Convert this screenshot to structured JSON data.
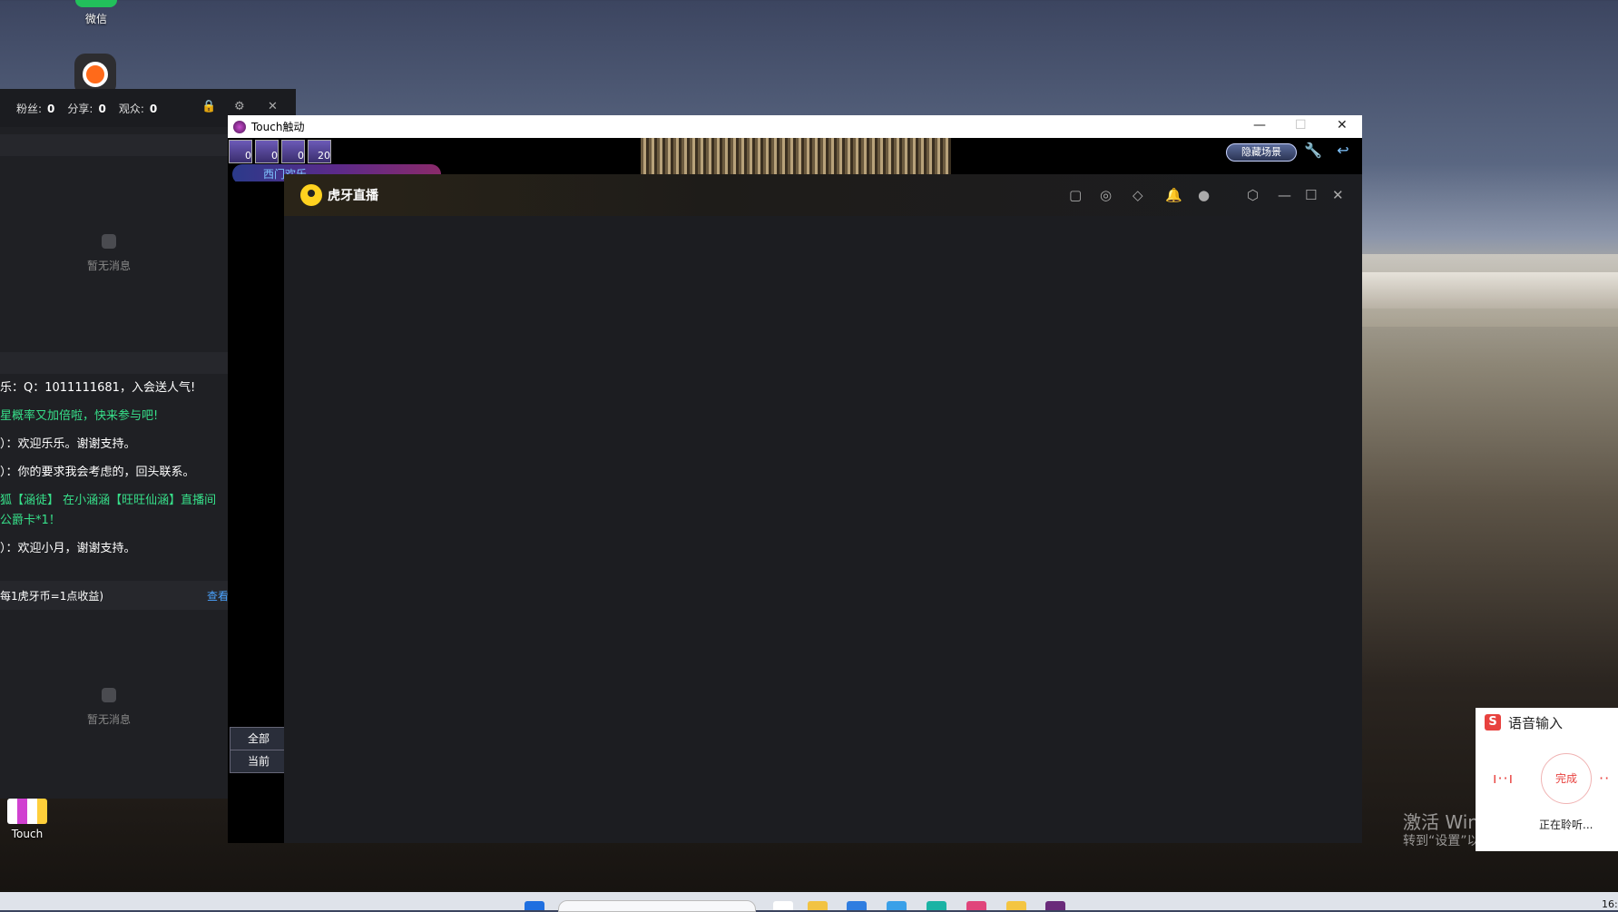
{
  "desktop": {
    "wechat_label": "微信",
    "touch_label": "Touch",
    "activate_line1": "激活 Windows",
    "activate_line2": "转到“设置”以激活 Windows。",
    "clock": "16:"
  },
  "left_panel": {
    "fans_label": "粉丝:",
    "fans_value": "0",
    "share_label": "分享:",
    "share_value": "0",
    "viewers_label": "观众:",
    "viewers_value": "0",
    "empty_top": "暂无消息",
    "empty_bottom": "暂无消息",
    "chat": [
      "乐：Q：1011111681，入会送人气!",
      "星概率又加倍啦，快来参与吧!",
      "）：欢迎乐乐。谢谢支持。",
      "）：你的要求我会考虑的，回头联系。",
      "狐【涵徒】 在小涵涵【旺旺仙涵】直播间",
      "公爵卡*1！",
      "）：欢迎小月，谢谢支持。"
    ],
    "coin_note": "每1虎牙币=1点收益)",
    "coin_link": "查看"
  },
  "game_window": {
    "title": "Touch触动",
    "badges": [
      "0",
      "0",
      "0",
      "20"
    ],
    "hide_scene": "隐藏场景",
    "player_name": "西门欢乐",
    "tab_all": "全部",
    "tab_current": "当前"
  },
  "huya_window": {
    "title": "虎牙直播"
  },
  "voice_input": {
    "title": "语音输入",
    "done": "完成",
    "listening": "正在聆听..."
  },
  "colors": {
    "chat_yellow": "#ffd24d",
    "chat_green": "#37e08a",
    "link_blue": "#4aa3ff",
    "huya_bg": "#1c1d21",
    "voice_red": "#e8423f"
  }
}
